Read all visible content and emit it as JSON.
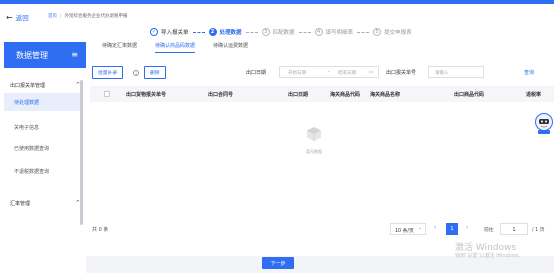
{
  "header": {
    "back_label": "返回",
    "breadcrumb": {
      "home": "首页",
      "current": "外贸综合服务企业代办退税申报"
    }
  },
  "steps": [
    {
      "num": "✓",
      "label": "导入报关单",
      "state": "done"
    },
    {
      "num": "2",
      "label": "处理数据",
      "state": "active"
    },
    {
      "num": "3",
      "label": "匹配数据",
      "state": "pending"
    },
    {
      "num": "4",
      "label": "填写明细表",
      "state": "pending"
    },
    {
      "num": "5",
      "label": "提交申报表",
      "state": "pending"
    }
  ],
  "sidebar": {
    "title": "数据管理",
    "groups": [
      {
        "label": "出口报关单管理",
        "expanded": true,
        "items": [
          "待处理数据",
          "关电子信息",
          "已使用数据查询",
          "不退税数据查询"
        ]
      },
      {
        "label": "汇率管理",
        "expanded": true,
        "items": []
      }
    ],
    "active_item": "待处理数据"
  },
  "tabs": [
    "待确定汇率数据",
    "待确认商品码数据",
    "待确认运费数据"
  ],
  "active_tab": "待确认商品码数据",
  "toolbar": {
    "batch_label": "批量补录",
    "delete_label": "删除",
    "date_label": "出口日期",
    "start_placeholder": "开始日期",
    "range_sep": "-",
    "end_placeholder": "结束日期",
    "decl_label": "出口报关单号",
    "decl_placeholder": "请输入",
    "query_label": "查询"
  },
  "table": {
    "columns": [
      "出口货物报关单号",
      "出口合同号",
      "出口日期",
      "海关商品代码",
      "海关商品名称",
      "出口商品代码",
      "退税率"
    ],
    "rows": [],
    "empty_text": "暂无数据"
  },
  "pagination": {
    "total": "共 0 条",
    "page_size": "10 条/页",
    "current_page": "1",
    "goto_label": "前往",
    "goto_value": "1",
    "page_count": "/ 1 页"
  },
  "next_button": "下一步",
  "watermark": {
    "line1": "激活 Windows",
    "line2": "转到\"设置\"以激活 Windows。"
  },
  "colors": {
    "accent": "#2f6ef2"
  }
}
